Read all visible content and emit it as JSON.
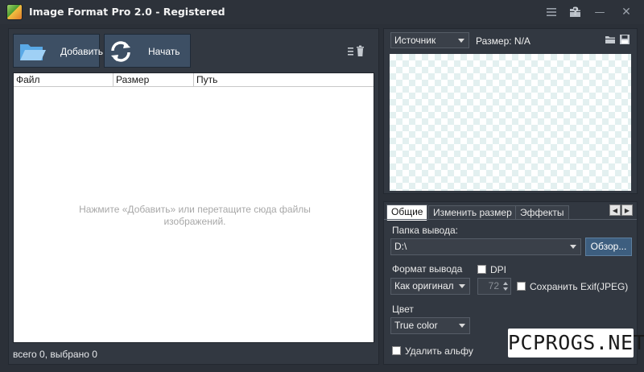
{
  "window": {
    "title": "Image Format Pro 2.0 - Registered",
    "controls": {
      "menu_icon": "menu-icon",
      "folder_icon": "folder-icon",
      "help_glyph": "?",
      "minimize_glyph": "—",
      "close_glyph": "✕"
    }
  },
  "toolbar": {
    "add_label": "Добавить",
    "start_label": "Начать"
  },
  "file_table": {
    "columns": [
      "Файл",
      "Размер",
      "Путь"
    ],
    "empty_hint": "Нажмите «Добавить» или перетащите сюда файлы изображений."
  },
  "status": {
    "text": "всего 0, выбрано 0"
  },
  "preview": {
    "source_select": "Источник",
    "size_label": "Размер: N/A"
  },
  "settings": {
    "tabs": [
      "Общие",
      "Изменить размер",
      "Эффекты"
    ],
    "output_folder_label": "Папка вывода:",
    "output_folder_value": "D:\\",
    "browse_label": "Обзор...",
    "output_format_label": "Формат вывода",
    "dpi_label": "DPI",
    "format_value": "Как оригинал",
    "dpi_value": "72",
    "exif_label": "Сохранить Exif(JPEG)",
    "color_label": "Цвет",
    "color_value": "True color",
    "remove_alpha_label": "Удалить альфу"
  },
  "watermark": {
    "text": "PCPROGS.NET"
  },
  "colors": {
    "background": "#2b3038",
    "panel": "#323841",
    "button": "#3d4f64",
    "accent_blue": "#3b8fd6"
  }
}
